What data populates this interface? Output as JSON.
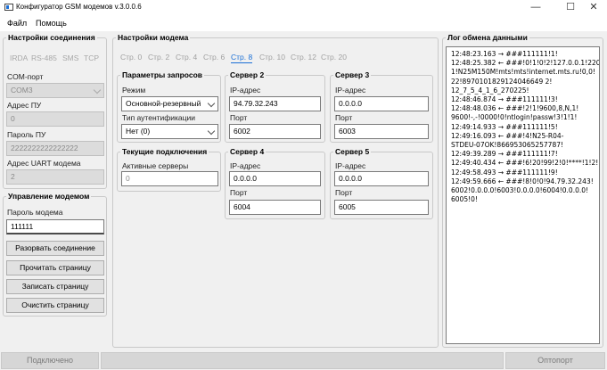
{
  "window": {
    "title": "Конфигуратор GSM модемов v.3.0.0.6",
    "minimize": "—",
    "maximize": "☐",
    "close": "✕"
  },
  "menu": {
    "file": "Файл",
    "help": "Помощь"
  },
  "connection": {
    "title": "Настройки соединения",
    "tabs": [
      "IRDA",
      "RS-485",
      "SMS",
      "TCP"
    ],
    "com_label": "COM-порт",
    "com_value": "COM3",
    "address_label": "Адрес ПУ",
    "address_value": "0",
    "password_label": "Пароль ПУ",
    "password_value": "2222222222222222",
    "uart_label": "Адрес UART модема",
    "uart_value": "2"
  },
  "modem_control": {
    "title": "Управление модемом",
    "password_label": "Пароль модема",
    "password_value": "111111",
    "disconnect": "Разорвать соединение",
    "read_page": "Прочитать страницу",
    "write_page": "Записать страницу",
    "clear_page": "Очистить страницу"
  },
  "modem_settings": {
    "title": "Настройки модема",
    "tabs": [
      "Стр. 0",
      "Стр. 2",
      "Стр. 4",
      "Стр. 6",
      "Стр. 8",
      "Стр. 10",
      "Стр. 12",
      "Стр. 20"
    ],
    "active_tab": "Стр. 8",
    "request_params": {
      "title": "Параметры запросов",
      "mode_label": "Режим",
      "mode_value": "Основной-резервный",
      "auth_label": "Тип аутентификации",
      "auth_value": "Нет (0)"
    },
    "current_connections": {
      "title": "Текущие подключения",
      "active_label": "Активные серверы",
      "active_value": "0"
    },
    "servers": [
      {
        "title": "Сервер 2",
        "ip_label": "IP-адрес",
        "ip": "94.79.32.243",
        "port_label": "Порт",
        "port": "6002"
      },
      {
        "title": "Сервер 3",
        "ip_label": "IP-адрес",
        "ip": "0.0.0.0",
        "port_label": "Порт",
        "port": "6003"
      },
      {
        "title": "Сервер 4",
        "ip_label": "IP-адрес",
        "ip": "0.0.0.0",
        "port_label": "Порт",
        "port": "6004"
      },
      {
        "title": "Сервер 5",
        "ip_label": "IP-адрес",
        "ip": "0.0.0.0",
        "port_label": "Порт",
        "port": "6005"
      }
    ]
  },
  "log": {
    "title": "Лог обмена данными",
    "text": "12:48:23.163 → ###111111!1!\n12:48:25.382 ← ###!0!1!0!2!127.0.0.1!2205!\n1!N25M150M!mts!mts!internet.mts.ru!0,0!\n22!8970101829124046649 2!\n12_7_5_4_1_6_270225!\n12:48:46.874 → ###111111!3!\n12:48:48.036 ← ###!2!1!9600,8,N,1!\n9600!-,-!0000!0!ntlogin!passw!3!1!1!\n12:49:14.933 → ###111111!5!\n12:49:16.093 ← ###!4!N25-R04-\nSTDEU-07OK!866953065257787!\n12:49:39.289 → ###111111!7!\n12:49:40.434 ← ###!6!20!99!2!0!****!1!2!\n12:49:58.493 → ###111111!9!\n12:49:59.666 ← ###!8!0!0!94.79.32.243!\n6002!0.0.0.0!6003!0.0.0.0!6004!0.0.0.0!\n6005!0!"
  },
  "status": {
    "left": "Подключено",
    "middle": "",
    "right": "Оптопорт"
  }
}
